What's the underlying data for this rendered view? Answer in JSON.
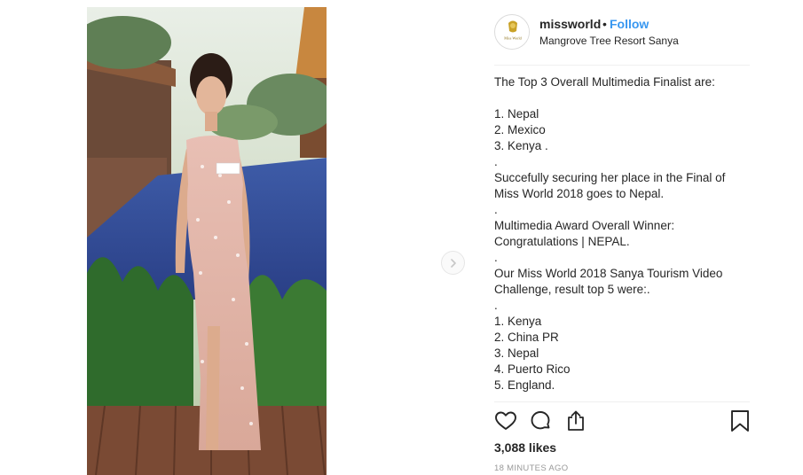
{
  "post": {
    "username": "missworld",
    "separator": "•",
    "follow_label": "Follow",
    "location": "Mangrove Tree Resort Sanya",
    "avatar_text": "Miss World",
    "caption_lines": [
      "The Top 3 Overall Multimedia Finalist are:",
      "",
      "1. Nepal",
      "2. Mexico",
      "3. Kenya .",
      ".",
      "Succefully securing her place in the Final of",
      "Miss World 2018 goes to Nepal.",
      ".",
      "Multimedia Award Overall Winner:",
      "Congratulations | NEPAL.",
      ".",
      "Our Miss World 2018 Sanya Tourism Video",
      "Challenge, result top 5 were:.",
      ".",
      "1. Kenya",
      "2. China PR",
      "3. Nepal",
      "4. Puerto Rico",
      "5. England."
    ],
    "likes": "3,088 likes",
    "timestamp": "18 MINUTES AGO"
  },
  "icons": {
    "like": "heart-icon",
    "comment": "comment-icon",
    "share": "share-icon",
    "save": "bookmark-icon",
    "next": "chevron-right-icon"
  },
  "colors": {
    "accent": "#3897f0",
    "text": "#262626",
    "muted": "#999999",
    "border": "#efefef"
  }
}
